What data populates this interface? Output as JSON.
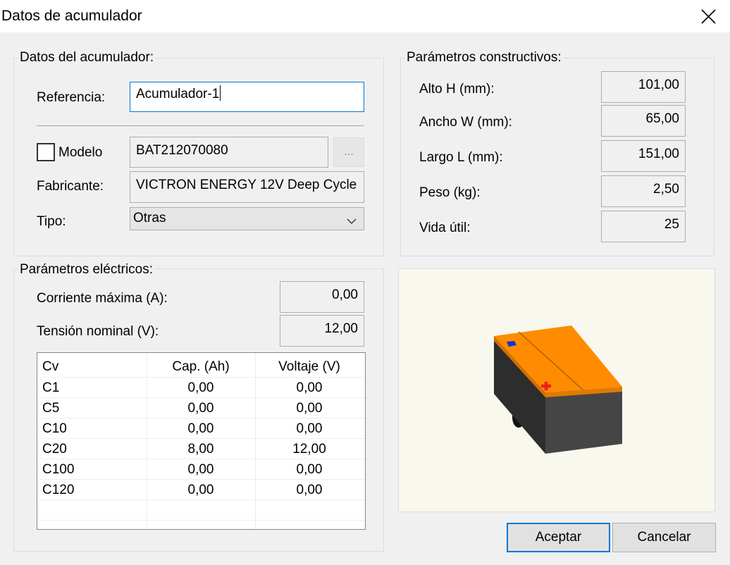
{
  "window": {
    "title": "Datos de acumulador",
    "close_icon": "close-icon"
  },
  "datos": {
    "group_title": "Datos del acumulador:",
    "referencia_label": "Referencia:",
    "referencia_value": "Acumulador-1",
    "modelo_label": "Modelo",
    "modelo_checked": false,
    "modelo_value": "BAT212070080",
    "browse_label": "...",
    "fabricante_label": "Fabricante:",
    "fabricante_value": "VICTRON ENERGY 12V Deep Cycle",
    "tipo_label": "Tipo:",
    "tipo_value": "Otras"
  },
  "constructivos": {
    "group_title": "Parámetros constructivos:",
    "alto_label": "Alto H (mm):",
    "alto_value": "101,00",
    "ancho_label": "Ancho W (mm):",
    "ancho_value": "65,00",
    "largo_label": "Largo L (mm):",
    "largo_value": "151,00",
    "peso_label": "Peso (kg):",
    "peso_value": "2,50",
    "vida_label": "Vida útil:",
    "vida_value": "25"
  },
  "electricos": {
    "group_title": "Parámetros eléctricos:",
    "corriente_label": "Corriente máxima (A):",
    "corriente_value": "0,00",
    "tension_label": "Tensión nominal (V):",
    "tension_value": "12,00",
    "table": {
      "headers": [
        "Cv",
        "Cap. (Ah)",
        "Voltaje (V)"
      ],
      "rows": [
        [
          "C1",
          "0,00",
          "0,00"
        ],
        [
          "C5",
          "0,00",
          "0,00"
        ],
        [
          "C10",
          "0,00",
          "0,00"
        ],
        [
          "C20",
          "8,00",
          "12,00"
        ],
        [
          "C100",
          "0,00",
          "0,00"
        ],
        [
          "C120",
          "0,00",
          "0,00"
        ]
      ]
    }
  },
  "preview": {
    "icon": "battery-3d-icon",
    "body_color": "#444444",
    "lid_color": "#ff8c00",
    "background": "#f8f8ef"
  },
  "buttons": {
    "accept_label": "Aceptar",
    "cancel_label": "Cancelar"
  }
}
